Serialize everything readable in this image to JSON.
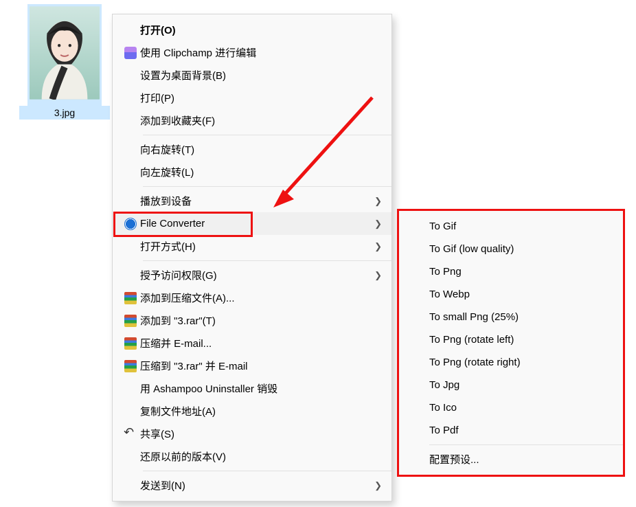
{
  "file": {
    "name": "3.jpg"
  },
  "menu": {
    "open": "打开(O)",
    "clipchamp": "使用 Clipchamp 进行编辑",
    "set_bg": "设置为桌面背景(B)",
    "print": "打印(P)",
    "add_fav": "添加到收藏夹(F)",
    "rot_right": "向右旋转(T)",
    "rot_left": "向左旋转(L)",
    "cast": "播放到设备",
    "file_converter": "File Converter",
    "open_with": "打开方式(H)",
    "grant_access": "授予访问权限(G)",
    "add_archive": "添加到压缩文件(A)...",
    "add_3rar": "添加到 \"3.rar\"(T)",
    "compress_email": "压缩并 E-mail...",
    "compress_3rar_email": "压缩到 \"3.rar\" 并 E-mail",
    "ashampoo": "用 Ashampoo Uninstaller 销毁",
    "copy_path": "复制文件地址(A)",
    "share": "共享(S)",
    "restore_prev": "还原以前的版本(V)",
    "send_to": "发送到(N)"
  },
  "submenu": {
    "to_gif": "To Gif",
    "to_gif_low": "To Gif (low quality)",
    "to_png": "To Png",
    "to_webp": "To Webp",
    "to_small_png": "To small Png (25%)",
    "to_png_rl": "To Png (rotate left)",
    "to_png_rr": "To Png (rotate right)",
    "to_jpg": "To Jpg",
    "to_ico": "To Ico",
    "to_pdf": "To Pdf",
    "configure": "配置预设..."
  }
}
